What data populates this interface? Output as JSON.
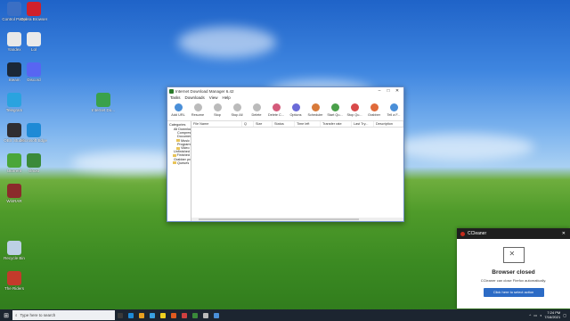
{
  "desktop_icons": [
    {
      "label": "Control Panel",
      "color": "#3b6fc4"
    },
    {
      "label": "Opera Browser",
      "color": "#d0202a"
    },
    {
      "label": "Yandex",
      "color": "#e8e8e8"
    },
    {
      "label": "Lol",
      "color": "#eaeaea"
    },
    {
      "label": "Steam",
      "color": "#1b2838"
    },
    {
      "label": "Discord",
      "color": "#5865f2"
    },
    {
      "label": "Telegram",
      "color": "#2aa3df"
    },
    {
      "label": "Internet Do...",
      "color": "#3aa14b"
    },
    {
      "label": "OBS Studio",
      "color": "#302e31"
    },
    {
      "label": "Microsoft Edge",
      "color": "#1e8ad6"
    },
    {
      "label": "Utorrent",
      "color": "#4aa63a"
    },
    {
      "label": "Ghost",
      "color": "#3a8a3a"
    },
    {
      "label": "WinRAR",
      "color": "#8b2b2b"
    },
    {
      "label": "Recycle Bin",
      "color": "#bcd0e4"
    },
    {
      "label": "The Riders",
      "color": "#c43a2b"
    }
  ],
  "idm": {
    "title": "Internet Download Manager 6.42",
    "menu": [
      "Tasks",
      "Downloads",
      "View",
      "Help"
    ],
    "toolbar": [
      {
        "label": "Add URL",
        "color": "#4a8fd8"
      },
      {
        "label": "Resume",
        "color": "#bbbbbb"
      },
      {
        "label": "Stop",
        "color": "#bbbbbb"
      },
      {
        "label": "Stop All",
        "color": "#bbbbbb"
      },
      {
        "label": "Delete",
        "color": "#bbbbbb"
      },
      {
        "label": "Delete C...",
        "color": "#d45a7a"
      },
      {
        "label": "Options",
        "color": "#6a6ad8"
      },
      {
        "label": "Scheduler",
        "color": "#d87a3a"
      },
      {
        "label": "Start Qu...",
        "color": "#4aa04a"
      },
      {
        "label": "Stop Qu...",
        "color": "#d84a4a"
      },
      {
        "label": "Grabber",
        "color": "#e06a3a"
      },
      {
        "label": "Tell a F...",
        "color": "#4a8fd8"
      }
    ],
    "categories_header": "Categories",
    "categories": [
      "All Downloads",
      "Compressed",
      "Documents",
      "Music",
      "Programs",
      "Video",
      "Unfinished",
      "Finished",
      "Grabber projects",
      "Queues"
    ],
    "columns": [
      "File Name",
      "Q",
      "Size",
      "Status",
      "Time left",
      "Transfer rate",
      "Last Try...",
      "Description"
    ]
  },
  "toast": {
    "app": "CCleaner",
    "close": "✕",
    "title": "Browser closed",
    "message": "CCleaner can close Firefox automatically.",
    "button": "Click here to select action"
  },
  "taskbar": {
    "search_placeholder": "Type here to search",
    "time": "7:24 PM",
    "date": "7/16/2021",
    "apps": [
      "#3a3a3a",
      "#1e8ad6",
      "#e8a020",
      "#3aa0e0",
      "#f0d020",
      "#e05a20",
      "#d04040",
      "#3a8a3a",
      "#bbbbbb",
      "#4a8fd8"
    ]
  }
}
